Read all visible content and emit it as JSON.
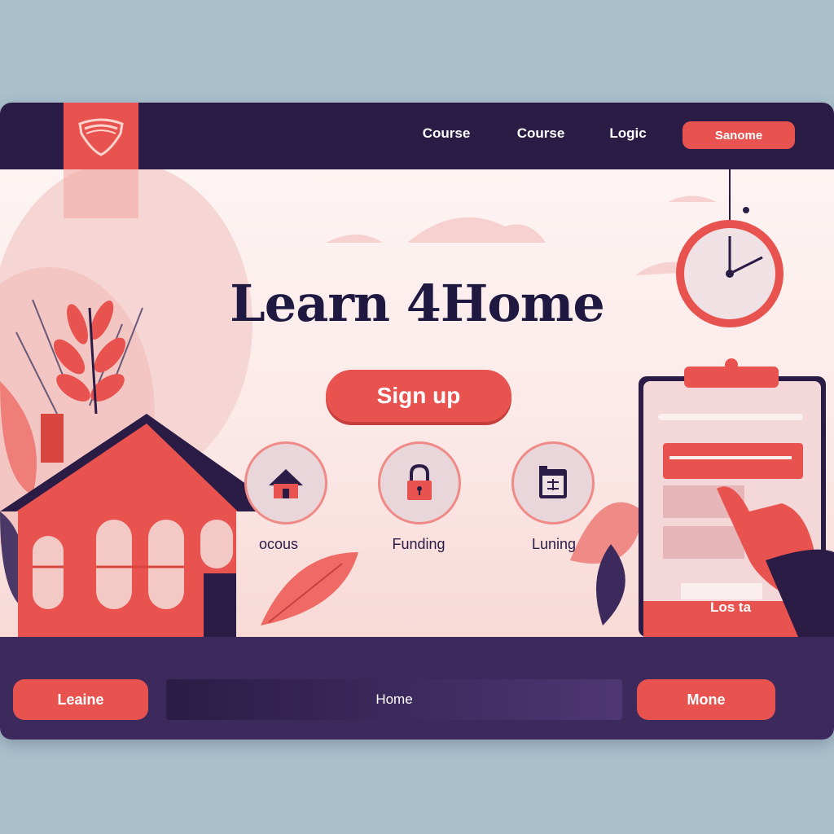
{
  "nav": {
    "links": [
      "Course",
      "Course",
      "Logic"
    ],
    "button": "Sanome"
  },
  "hero": {
    "title": "Learn 4Home",
    "signup": "Sign up"
  },
  "features": [
    {
      "label": "ocous",
      "icon": "house-icon"
    },
    {
      "label": "Funding",
      "icon": "lock-icon"
    },
    {
      "label": "Luning",
      "icon": "calendar-icon"
    }
  ],
  "clipboard": {
    "link": "Los ta"
  },
  "footer": {
    "left_button": "Leaine",
    "field": "Home",
    "right_button": "Mone"
  },
  "colors": {
    "accent": "#e8534f",
    "navy": "#2a1c45",
    "footer": "#3d2a5c"
  }
}
